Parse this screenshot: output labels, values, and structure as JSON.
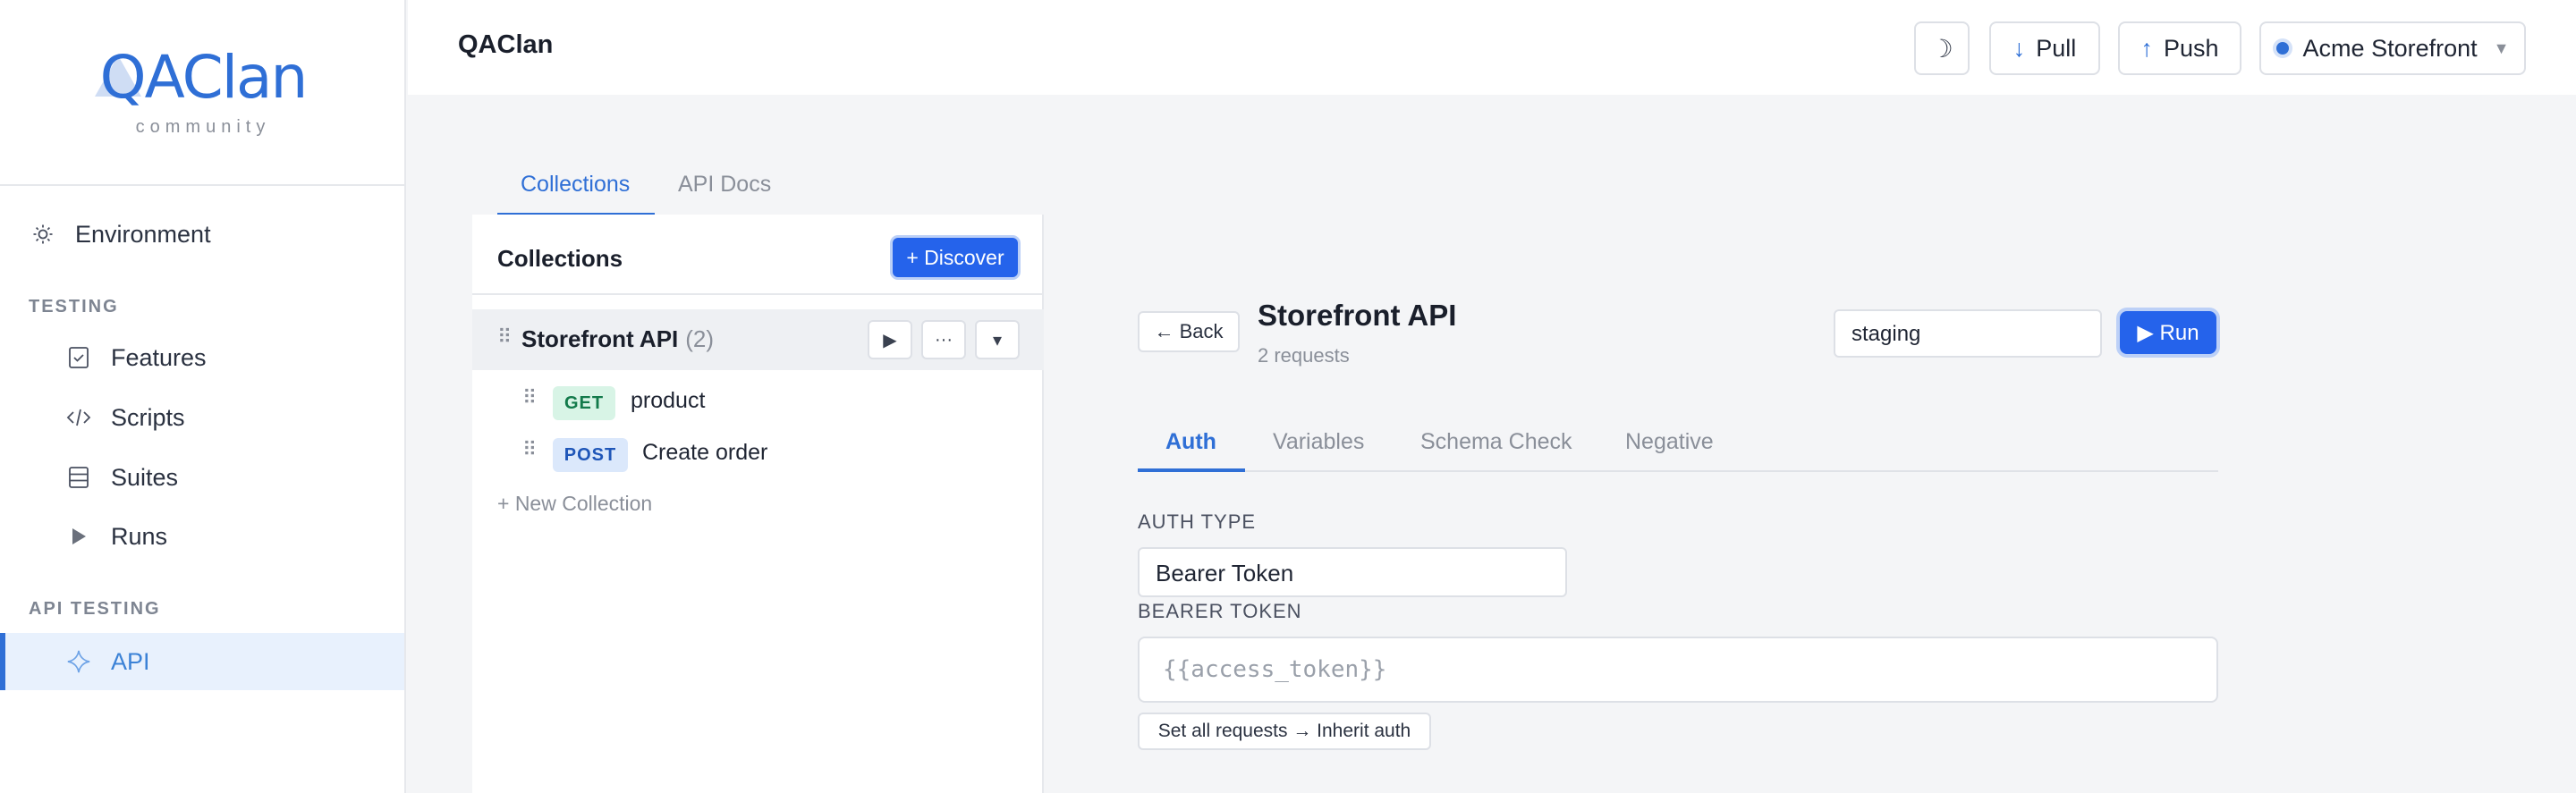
{
  "sidebar": {
    "logo": "QAClan",
    "logo_sub": "community",
    "environment_label": "Environment",
    "sections": [
      {
        "title": "TESTING",
        "items": [
          "Features",
          "Scripts",
          "Suites",
          "Runs"
        ]
      },
      {
        "title": "API TESTING",
        "items": [
          "API"
        ]
      }
    ],
    "active_item": "API"
  },
  "header": {
    "title": "QAClan",
    "theme_icon": "moon-icon",
    "pull_label": "Pull",
    "push_label": "Push",
    "project_label": "Acme Storefront"
  },
  "top_tabs": [
    "Collections",
    "API Docs"
  ],
  "collections": {
    "heading": "Collections",
    "discover_label": "+ Discover",
    "items": [
      {
        "name": "Storefront API",
        "count": "(2)",
        "requests": [
          {
            "method": "GET",
            "name": "product"
          },
          {
            "method": "POST",
            "name": "Create order"
          }
        ]
      }
    ],
    "new_collection_label": "+ New Collection"
  },
  "request": {
    "back_label": "← Back",
    "title": "Storefront API",
    "subtitle": "2 requests",
    "env_value": "staging",
    "run_label": "▶ Run",
    "tabs": [
      "Auth",
      "Variables",
      "Schema Check",
      "Negative"
    ],
    "auth_type_label": "AUTH TYPE",
    "auth_type_value": "Bearer Token",
    "bearer_label": "BEARER TOKEN",
    "bearer_placeholder": "{{access_token}}",
    "inherit_label": "Set all requests → Inherit auth"
  },
  "colors": {
    "accent": "#2563eb",
    "active_bg": "#e8f1fd",
    "get": "#137a4b",
    "post": "#1f56b8"
  }
}
